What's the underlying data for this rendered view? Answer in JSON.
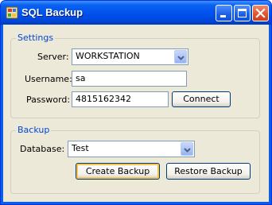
{
  "window": {
    "title": "SQL Backup"
  },
  "icons": {
    "app": "database-app-icon",
    "minimize": "minimize-icon",
    "maximize": "maximize-icon",
    "close": "close-icon",
    "dropdown": "chevron-down-icon"
  },
  "settings": {
    "legend": "Settings",
    "server_label": "Server:",
    "server_value": "WORKSTATION",
    "username_label": "Username:",
    "username_value": "sa",
    "password_label": "Password:",
    "password_value": "4815162342",
    "connect_label": "Connect"
  },
  "backup": {
    "legend": "Backup",
    "database_label": "Database:",
    "database_value": "Test",
    "create_label": "Create Backup",
    "restore_label": "Restore Backup"
  },
  "colors": {
    "title_bar": "#0050ee",
    "client_bg": "#ece9d8",
    "group_text": "#0046d5",
    "close_button": "#e2552e"
  }
}
